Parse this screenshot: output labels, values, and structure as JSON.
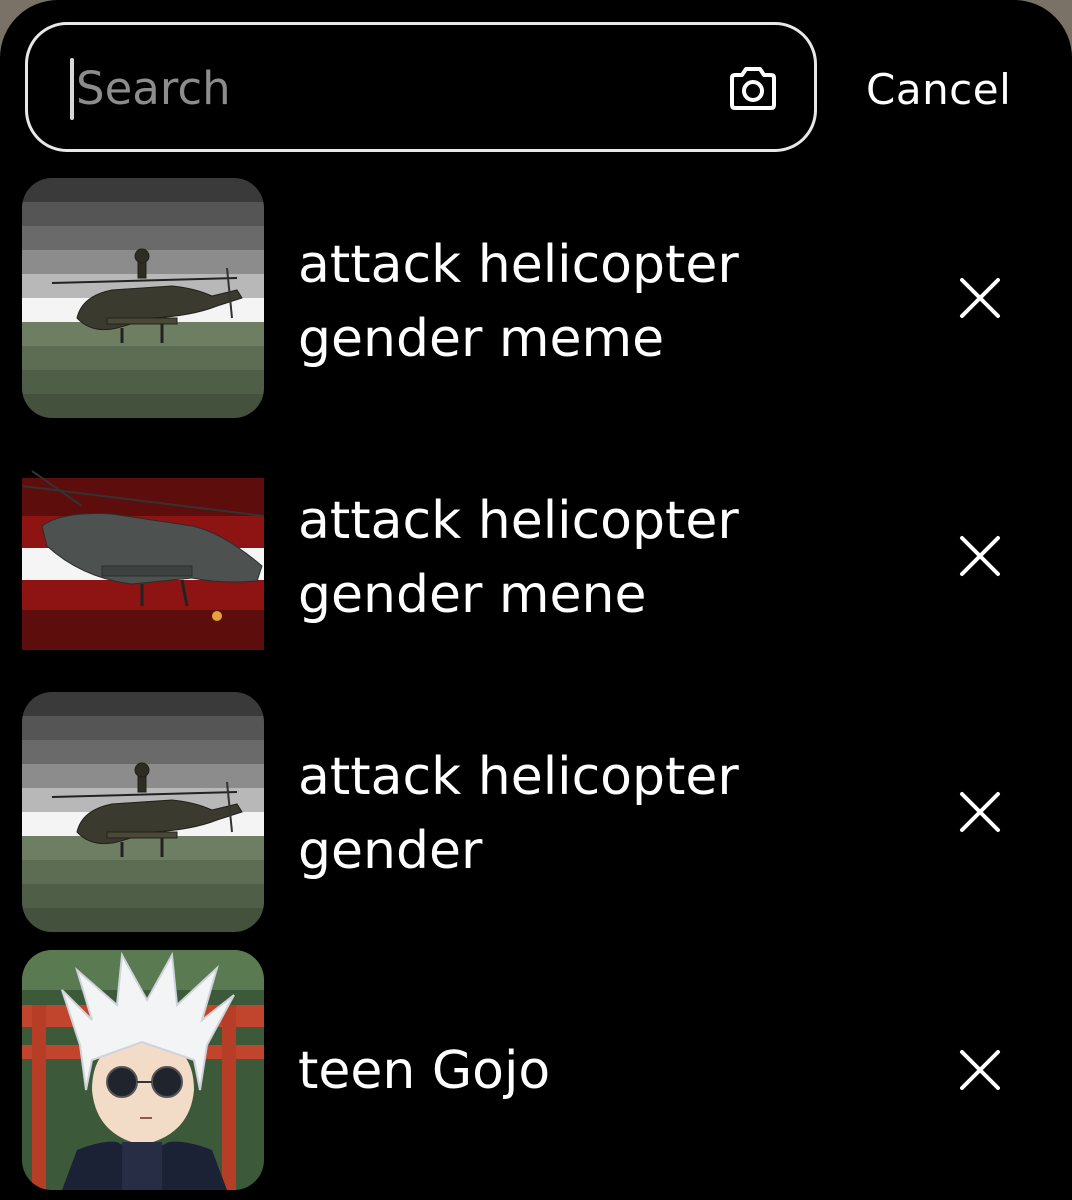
{
  "search": {
    "placeholder": "Search",
    "value": "",
    "cancel_label": "Cancel"
  },
  "icons": {
    "camera": "camera-icon",
    "remove": "close-icon"
  },
  "colors": {
    "background": "#000000",
    "text": "#ffffff",
    "placeholder": "#8c8c8c"
  },
  "recent_searches": [
    {
      "label_line1": "attack helicopter",
      "label_line2": "gender meme"
    },
    {
      "label_line1": "attack helicopter",
      "label_line2": "gender mene"
    },
    {
      "label_line1": "attack helicopter",
      "label_line2": "gender"
    },
    {
      "label_line1": "teen Gojo",
      "label_line2": ""
    }
  ]
}
